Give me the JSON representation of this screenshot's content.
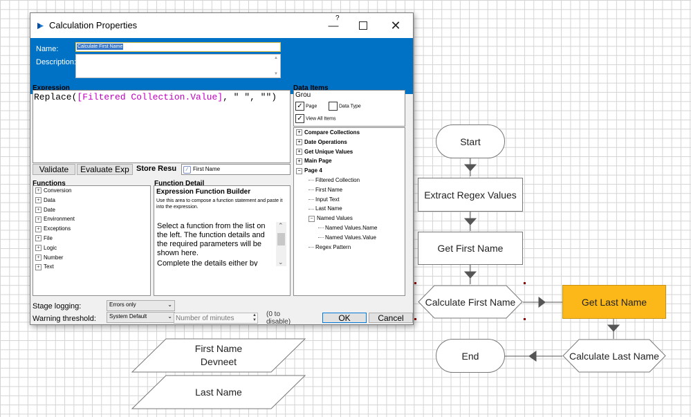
{
  "flow": {
    "start": "Start",
    "extract": "Extract Regex Values",
    "get_first": "Get First Name",
    "calc_first": "Calculate First Name",
    "get_last": "Get Last Name",
    "calc_last": "Calculate Last Name",
    "end": "End",
    "first_name_label": "First Name",
    "first_name_value": "Devneet",
    "last_name_label": "Last Name"
  },
  "dialog": {
    "title": "Calculation Properties",
    "help": "?",
    "name_label": "Name:",
    "name_value": "Calculate First Name",
    "description_label": "Description:",
    "expression_label": "Expression",
    "expression_func": "Replace(",
    "expression_arg1": "[Filtered Collection.Value]",
    "expression_rest": ", \" \", \"\")",
    "data_items_label": "Data Items",
    "group_label": "Grou",
    "page_check": "Page",
    "datatype_check": "Data Type",
    "viewall_check": "View All Items",
    "validate": "Validate",
    "evaluate": "Evaluate Exp",
    "store_result_label": "Store Resu",
    "store_result_value": "First Name",
    "functions_label": "Functions",
    "function_detail_label": "Function Detail",
    "builder_title": "Expression Function Builder",
    "builder_desc": "Use this area to compose a function statement and paste it into the expression.",
    "builder_text1": "Select a function from the list on the left. The function details and the required parameters will be shown here.",
    "builder_text2": "Complete the details either by",
    "stage_logging_label": "Stage logging:",
    "stage_logging_value": "Errors only",
    "warning_label": "Warning threshold:",
    "warning_value": "System Default",
    "minutes_placeholder": "Number of minutes",
    "disable_note": "(0 to disable)",
    "ok": "OK",
    "cancel": "Cancel"
  },
  "functions": [
    "Conversion",
    "Data",
    "Date",
    "Environment",
    "Exceptions",
    "File",
    "Logic",
    "Number",
    "Text"
  ],
  "data_items": [
    {
      "label": "Compare Collections",
      "bold": true
    },
    {
      "label": "Date Operations",
      "bold": true
    },
    {
      "label": "Get Unique Values",
      "bold": true
    },
    {
      "label": "Main Page",
      "bold": true
    },
    {
      "label": "Page 4",
      "bold": true
    },
    {
      "label": "Filtered Collection",
      "bold": false
    },
    {
      "label": "First Name",
      "bold": false
    },
    {
      "label": "Input Text",
      "bold": false
    },
    {
      "label": "Last Name",
      "bold": false
    },
    {
      "label": "Named Values",
      "bold": false
    },
    {
      "label": "Named Values.Name",
      "bold": false
    },
    {
      "label": "Named Values.Value",
      "bold": false
    },
    {
      "label": "Regex Pattern",
      "bold": false
    }
  ],
  "colors": {
    "accent_blue": "#0072c6",
    "active_stage": "#fcb718",
    "expr_magenta": "#c000c0"
  }
}
